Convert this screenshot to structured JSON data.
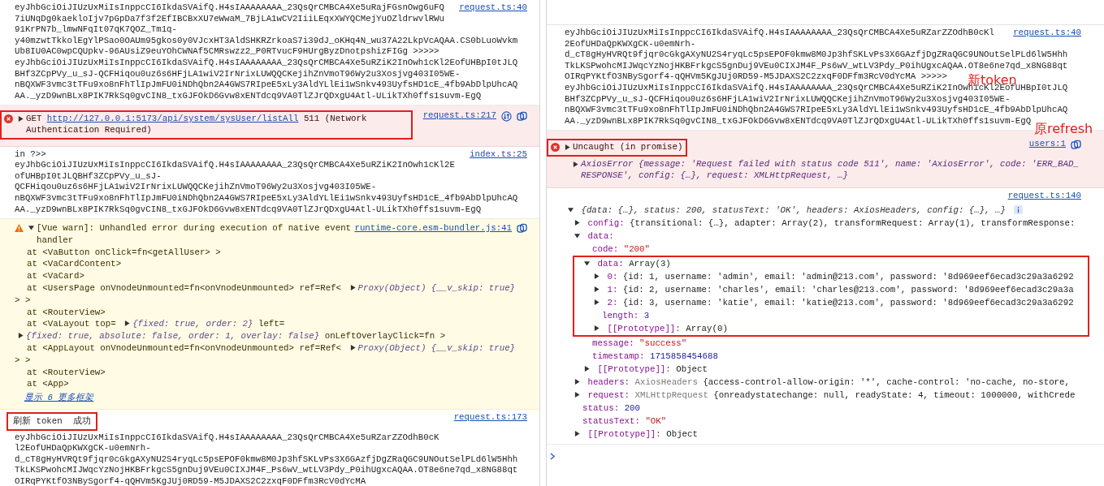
{
  "left_console": {
    "messages": [
      {
        "kind": "log",
        "source": "request.ts:40",
        "lines": [
          "eyJhbGciOiJIUzUxMiIsInppcCI6IkdaSVAifQ.H4sIAAAAAAAA_23QsQrCMBCA4Xe5uRajFGsnOwg6uFQ",
          "7iUNqDg0kaekloIjv7pGpDa7f3f2EfIBCBxXU7eWwaM_7BjLA1wCV2IiiLEqxXWYQCMejYuOZldrwvlRWu",
          "91KrPN7b_lmwNFqIt07qK7QOZ_Tm1q-",
          "y40mzwtTkkolEgYlPSao0OAUm95gkos0y0VJcxHT3AldSHKRZrkoaS7i39dJ_oKHq4N_wu37A22LkpVcAQAA.CS0bLuoWvkm",
          "Ub8IU0AC0wpCQUpkv-96AUsiZ9euYOhCWNAf5CMRswzz2_P0RTvucF9HUrgByzDnotpshizFIGg >>>>>",
          "eyJhbGciOiJIUzUxMiIsInppcCI6IkdaSVAifQ.H4sIAAAAAAAA_23QsQrCMBCA4Xe5uRZiK2InOwh1cKl2EofUHBpI0tJLQ",
          "BHf3ZCpPVy_u_sJ-QCFHiqou0uz6s6HFjLA1wiV2IrNrixLUWQQCKejihZnVmoT96Wy2u3Xosjvg403I05WE-",
          "nBQXWF3vmc3tTFu9xo8nFhTlIpJmFU0iNDhQbn2A4GWS7RIpeE5xLy3AldYLlEi1wSnkv493UyfsHD1cE_4fb9AbDlpUhcAQ",
          "AA._yzD9wnBLx8PIK7RkSq0gvCIN8_txGJFOkD6Gvw8xENTdcq9VA0TlZJrQDxgU4Atl-ULikTXh0ffs1suvm-EgQ"
        ]
      },
      {
        "kind": "error",
        "source": "request.ts:217",
        "expanded": false,
        "boxed": true,
        "segments": [
          {
            "kind": "text",
            "text": "GET"
          },
          {
            "kind": "link",
            "text": "http://127.0.0.1:5173/api/system/sysUser/listAll"
          },
          {
            "kind": "text",
            "text": "511 (Network Authentication Required)"
          }
        ]
      },
      {
        "kind": "log",
        "source": "index.ts:25",
        "lines": [
          "in ?>>",
          "eyJhbGciOiJIUzUxMiIsInppcCI6IkdaSVAifQ.H4sIAAAAAAAA_23QsQrCMBCA4Xe5uRZiK2InOwh1cKl2E",
          "ofUHBpI0tJLQBHf3ZCpPVy_u_sJ-",
          "QCFHiqou0uz6s6HFjLA1wiV2IrNrixLUWQQCKejihZnVmoT96Wy2u3Xosjvg403I05WE-",
          "nBQXWF3vmc3tTFu9xo8nFhTlIpJmFU0iNDhQbn2A4GWS7RIpeE5xLy3AldYLlEi1wSnkv493UyfsHD1cE_4fb9AbDlpUhcAQ",
          "AA._yzD9wnBLx8PIK7RkSq0gvCIN8_txGJFOkD6Gvw8xENTdcq9VA0TlZJrQDxgU4Atl-ULikTXh0ffs1suvm-EgQ"
        ]
      },
      {
        "kind": "warning",
        "source": "runtime-core.esm-bundler.js:41",
        "expanded": true,
        "head": "[Vue warn]: Unhandled error during execution of native event handler",
        "frames": [
          {
            "segments": [
              {
                "kind": "text",
                "text": "at <VaButton onClick=fn<getAllUser> >"
              }
            ]
          },
          {
            "segments": [
              {
                "kind": "text",
                "text": "at <VaCardContent>"
              }
            ]
          },
          {
            "segments": [
              {
                "kind": "text",
                "text": "at <VaCard>"
              }
            ]
          },
          {
            "segments": [
              {
                "kind": "text",
                "text": "at <UsersPage onVnodeUnmounted=fn<onVnodeUnmounted> ref=Ref<"
              },
              {
                "kind": "object",
                "expanded": false,
                "text": "Proxy(Object) {__v_skip: true}"
              },
              {
                "kind": "text",
                "text": "> >"
              }
            ]
          },
          {
            "segments": [
              {
                "kind": "text",
                "text": "at <RouterView>"
              }
            ]
          },
          {
            "segments": [
              {
                "kind": "text",
                "text": "at <VaLayout top="
              },
              {
                "kind": "object",
                "expanded": false,
                "text": "{fixed: true, order: 2}"
              },
              {
                "kind": "text",
                "text": "left="
              },
              {
                "kind": "object",
                "expanded": false,
                "text": "{fixed: true, absolute: false, order: 1, overlay: false}"
              },
              {
                "kind": "text",
                "text": "onLeftOverlayClick=fn >"
              }
            ]
          },
          {
            "segments": [
              {
                "kind": "text",
                "text": "at <AppLayout onVnodeUnmounted=fn<onVnodeUnmounted> ref=Ref<"
              },
              {
                "kind": "object",
                "expanded": false,
                "text": "Proxy(Object) {__v_skip: true}"
              },
              {
                "kind": "text",
                "text": "> >"
              }
            ]
          },
          {
            "segments": [
              {
                "kind": "text",
                "text": "at <RouterView>"
              }
            ]
          },
          {
            "segments": [
              {
                "kind": "text",
                "text": "at <App>"
              }
            ]
          }
        ],
        "more_link": "显示 6 更多框架"
      },
      {
        "kind": "log",
        "source": "request.ts:173",
        "lead": {
          "text": "刷新 token  成功",
          "boxed": true
        },
        "lines": [
          "eyJhbGciOiJIUzUxMiIsInppcCI6IkdaSVAifQ.H4sIAAAAAAAA_23QsQrCMBCA4Xe5uRZarZZOdhB0cK",
          "l2EofUHDaQpKWXgCK-u0emNrh-",
          "d_cT8gHyHVRQt9fjqr0cGkgAXyNU2S4ryqLc5psEPOF0kmw8M0Jp3hfSKLvPs3X6GAzfjDgZRaQGC9UNOutSelPLd6lW5Hhh",
          "TkLKSPwohcMIJWqcYzNojHKBFrkgcS5gnDuj9VEu0CIXJM4F_Ps6wV_wtLV3Pdy_P0ihUgxcAQAA.OT8e6ne7qd_x8NG88qt",
          "OIRqPYKtfO3NBySgorf4-qQHVm5KgJUj0RD59-M5JDAXS2C2zxqF0DFfm3RcV0dYcMA"
        ]
      }
    ]
  },
  "right_console": {
    "messages": [
      {
        "kind": "log",
        "source": "request.ts:40",
        "lines": [
          "eyJhbGciOiJIUzUxMiIsInppcCI6IkdaSVAifQ.H4sIAAAAAAAA_23QsQrCMBCA4Xe5uRZarZZOdhB0cKl",
          "2EofUHDaQpKWXgCK-u0emNrh-",
          "d_cT8gHyHVRQt9fjqr0cGkgAXyNU2S4ryqLc5psEPOF0kmw8M0Jp3hfSKLvPs3X6GAzfjDgZRaQGC9UNOutSelPLd6lW5Hhh",
          "TkLKSPwohcMIJWqcYzNojHKBFrkgcS5gnDuj9VEu0CIXJM4F_Ps6wV_wtLV3Pdy_P0ihUgxcAQAA.OT8e6ne7qd_x8NG88qt",
          "OIRqPYKtfO3NBySgorf4-qQHVm5KgJUj0RD59-M5JDAXS2C2zxqF0DFfm3RcV0dYcMA >>>>>",
          "eyJhbGciOiJIUzUxMiIsInppcCI6IkdaSVAifQ.H4sIAAAAAAAA_23QsQrCMBCA4Xe5uRZiK2InOwh1cKl2EofUHBpI0tJLQ",
          "BHf3ZCpPVy_u_sJ-QCFHiqou0uz6s6HFjLA1wiV2IrNrixLUWQQCKejihZnVmoT96Wy2u3Xosjvg403I05WE-",
          "nBQXWF3vmc3tTFu9xo8nFhTlIpJmFU0iNDhQbn2A4GWS7RIpeE5xLy3AldYLlEi1wSnkv493UyfsHD1cE_4fb9AbDlpUhcAQ",
          "AA._yzD9wnBLx8PIK7RkSq0gvCIN8_txGJFOkD6Gvw8xENTdcq9VA0TlZJrQDxgU4Atl-ULikTXh0ffs1suvm-EgQ"
        ]
      },
      {
        "kind": "error",
        "source": "users:1",
        "expanded": false,
        "boxed": true,
        "segments": [
          {
            "kind": "text",
            "text": "Uncaught (in promise)"
          }
        ],
        "detail": {
          "expanded": false,
          "text": "AxiosError {message: 'Request failed with status code 511', name: 'AxiosError', code: 'ERR_BAD_RESPONSE', config: {…}, request: XMLHttpRequest, …}"
        }
      },
      {
        "kind": "object",
        "source": "request.ts:140",
        "expanded": true,
        "summary": "{data: {…}, status: 200, statusText: 'OK', headers: AxiosHeaders, config: {…}, …}",
        "children": [
          {
            "key": "config:",
            "kind": "object",
            "expanded": false,
            "value": "{transitional: {…}, adapter: Array(2), transformRequest: Array(1), transformResponse:"
          },
          {
            "key": "data:",
            "expanded": true,
            "children": [
              {
                "key": "code:",
                "kind": "string",
                "value": "\"200\""
              },
              {
                "key": "data:",
                "kind": "object",
                "expanded": true,
                "boxed": true,
                "value": "Array(3)",
                "children": [
                  {
                    "key": "0:",
                    "kind": "object",
                    "expanded": false,
                    "value": "{id: 1, username: 'admin', email: 'admin@213.com', password: '8d969eef6ecad3c29a3a6292"
                  },
                  {
                    "key": "1:",
                    "kind": "object",
                    "expanded": false,
                    "value": "{id: 2, username: 'charles', email: 'charles@213.com', password: '8d969eef6ecad3c29a3a"
                  },
                  {
                    "key": "2:",
                    "kind": "object",
                    "expanded": false,
                    "value": "{id: 3, username: 'katie', email: 'katie@213.com', password: '8d969eef6ecad3c29a3a6292"
                  },
                  {
                    "key": "length:",
                    "kind": "number",
                    "value": "3"
                  },
                  {
                    "key": "[[Prototype]]:",
                    "kind": "object",
                    "expanded": false,
                    "value": "Array(0)"
                  }
                ]
              },
              {
                "key": "message:",
                "kind": "string",
                "value": "\"success\""
              },
              {
                "key": "timestamp:",
                "kind": "number",
                "value": "1715858454688"
              },
              {
                "key": "[[Prototype]]:",
                "kind": "object",
                "expanded": false,
                "value": "Object"
              }
            ]
          },
          {
            "key": "headers:",
            "kind": "object",
            "expanded": false,
            "class_name": "AxiosHeaders",
            "value": "{access-control-allow-origin: '*', cache-control: 'no-cache, no-store,"
          },
          {
            "key": "request:",
            "kind": "object",
            "expanded": false,
            "class_name": "XMLHttpRequest",
            "value": "{onreadystatechange: null, readyState: 4, timeout: 1000000, withCrede"
          },
          {
            "key": "status:",
            "kind": "number",
            "value": "200"
          },
          {
            "key": "statusText:",
            "kind": "string",
            "value": "\"OK\""
          },
          {
            "key": "[[Prototype]]:",
            "kind": "object",
            "expanded": false,
            "value": "Object"
          }
        ]
      }
    ],
    "annotations": [
      "新token",
      "原refresh"
    ]
  }
}
